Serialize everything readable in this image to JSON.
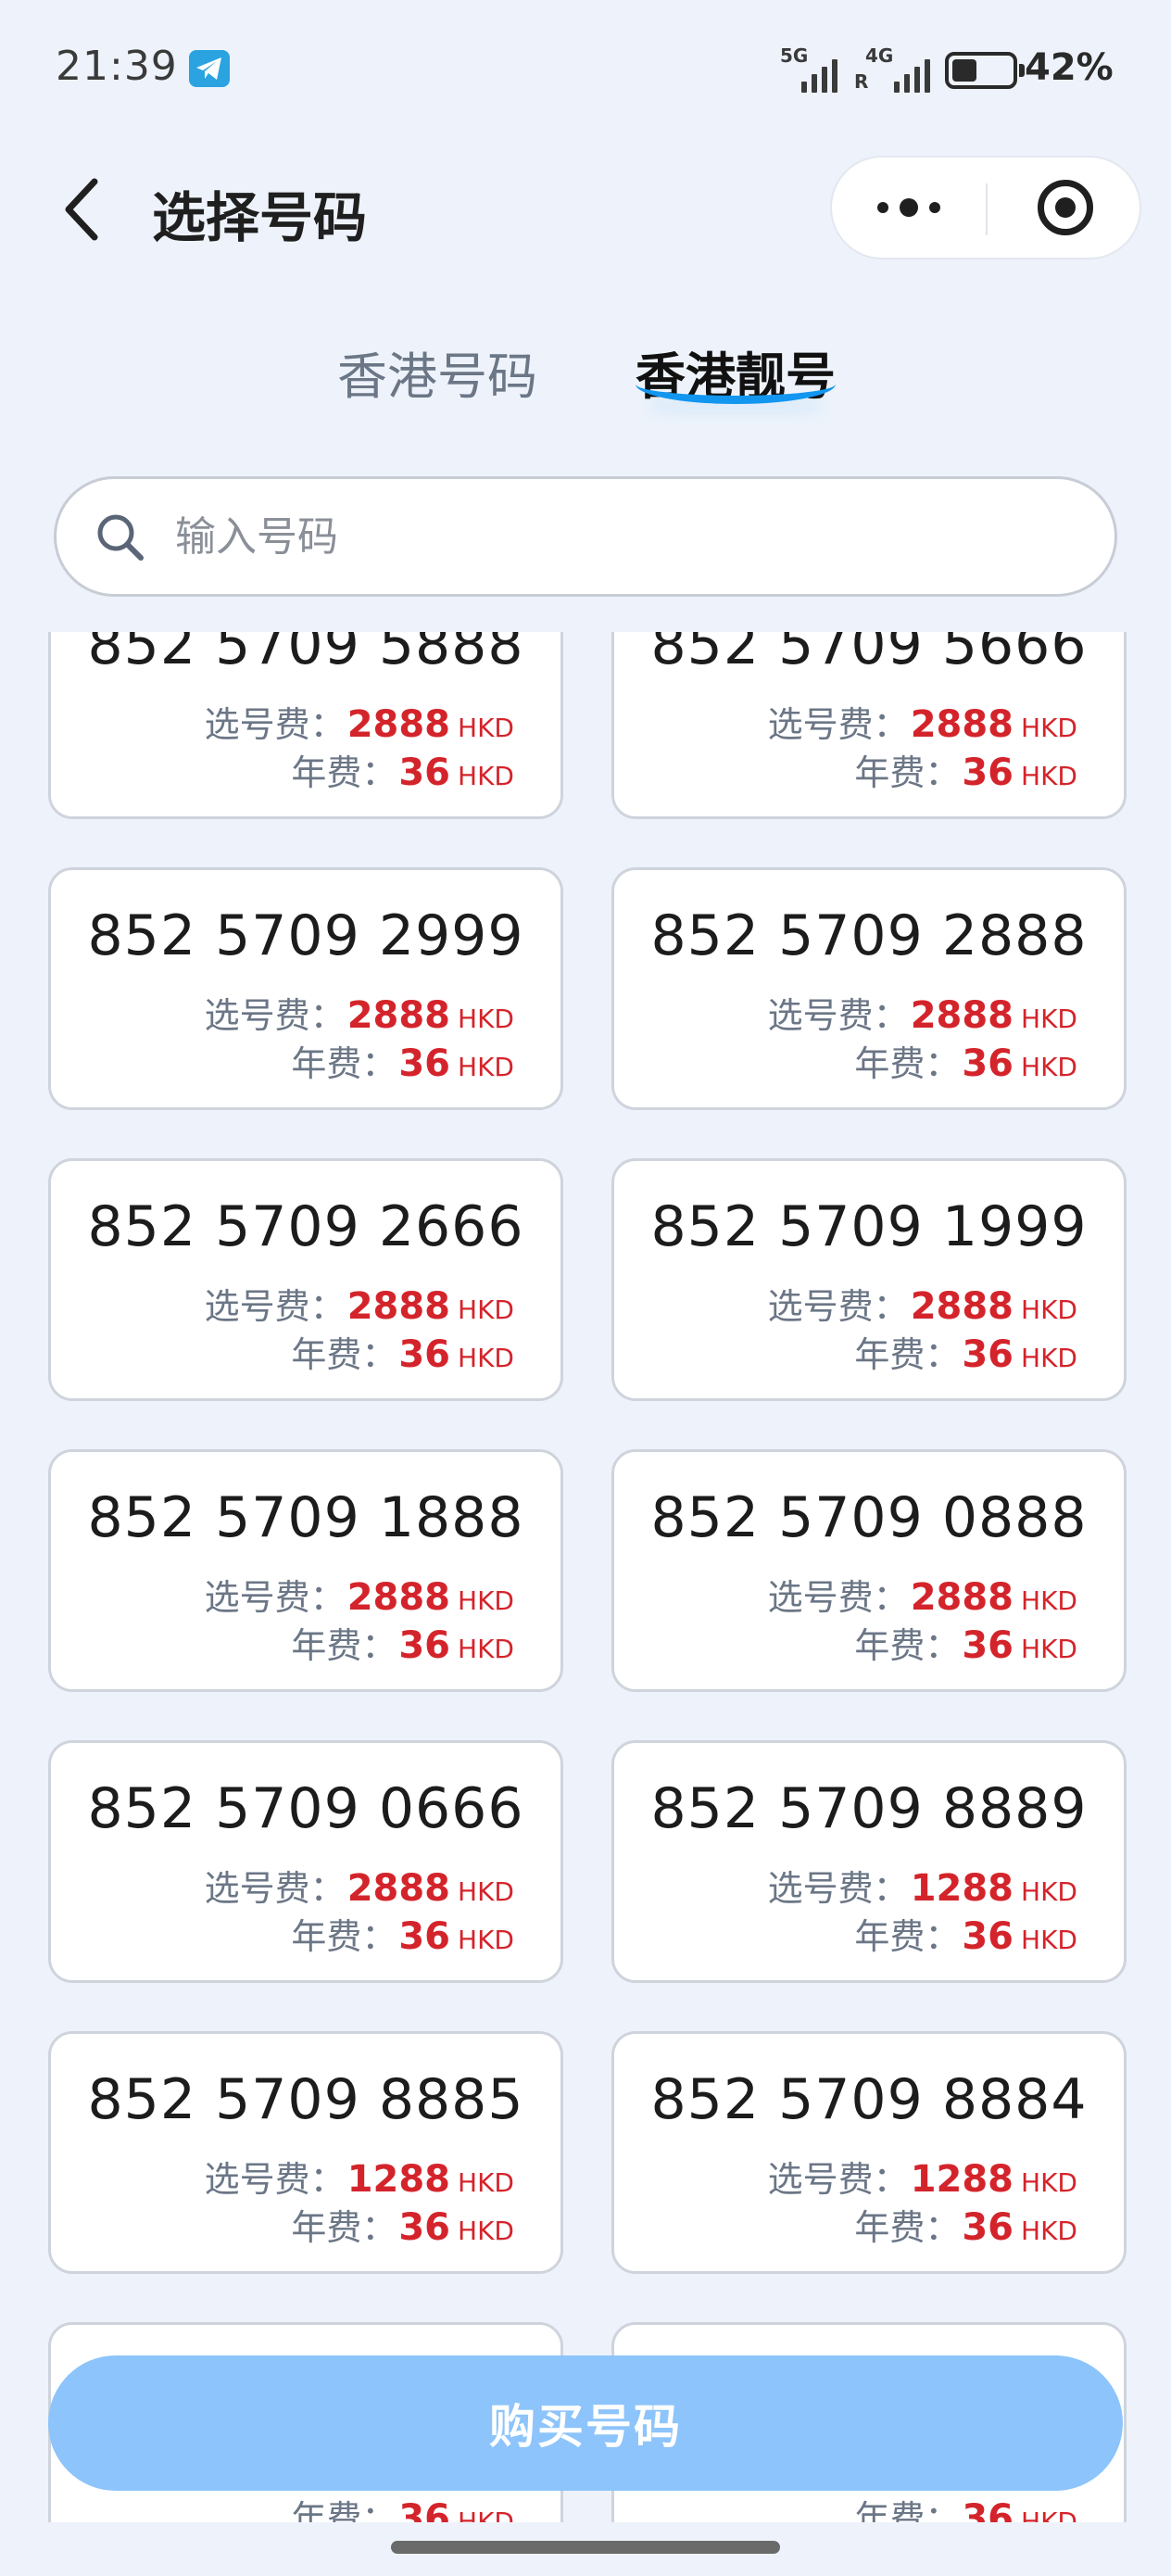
{
  "status_bar": {
    "time": "21:39",
    "net1": "5G",
    "net2": "4G",
    "net2_sub": "R",
    "battery_level": 0.42,
    "battery_text": "42%"
  },
  "header": {
    "title": "选择号码"
  },
  "tabs": [
    {
      "label": "香港号码",
      "active": false
    },
    {
      "label": "香港靓号",
      "active": true
    }
  ],
  "search": {
    "placeholder": "输入号码",
    "value": ""
  },
  "price_labels": {
    "select_fee": "选号费：",
    "annual_fee": "年费：",
    "currency": "HKD"
  },
  "numbers": [
    {
      "number": "852 5709 5888",
      "select_fee": "2888",
      "annual_fee": "36"
    },
    {
      "number": "852 5709 5666",
      "select_fee": "2888",
      "annual_fee": "36"
    },
    {
      "number": "852 5709 2999",
      "select_fee": "2888",
      "annual_fee": "36"
    },
    {
      "number": "852 5709 2888",
      "select_fee": "2888",
      "annual_fee": "36"
    },
    {
      "number": "852 5709 2666",
      "select_fee": "2888",
      "annual_fee": "36"
    },
    {
      "number": "852 5709 1999",
      "select_fee": "2888",
      "annual_fee": "36"
    },
    {
      "number": "852 5709 1888",
      "select_fee": "2888",
      "annual_fee": "36"
    },
    {
      "number": "852 5709 0888",
      "select_fee": "2888",
      "annual_fee": "36"
    },
    {
      "number": "852 5709 0666",
      "select_fee": "2888",
      "annual_fee": "36"
    },
    {
      "number": "852 5709 8889",
      "select_fee": "1288",
      "annual_fee": "36"
    },
    {
      "number": "852 5709 8885",
      "select_fee": "1288",
      "annual_fee": "36"
    },
    {
      "number": "852 5709 8884",
      "select_fee": "1288",
      "annual_fee": "36"
    },
    {
      "number": "",
      "select_fee": "",
      "annual_fee": "36"
    },
    {
      "number": "",
      "select_fee": "",
      "annual_fee": "36"
    }
  ],
  "buy_button": {
    "label": "购买号码"
  },
  "colors": {
    "price_red": "#d4242b",
    "accent_blue": "#1296f0",
    "buy_button": "#8cc4fb",
    "background": "#eef3fb"
  },
  "icons": {
    "back": "chevron-left-icon",
    "more": "more-dots-icon",
    "close": "target-circle-icon",
    "search": "search-icon",
    "telegram": "telegram-icon"
  }
}
